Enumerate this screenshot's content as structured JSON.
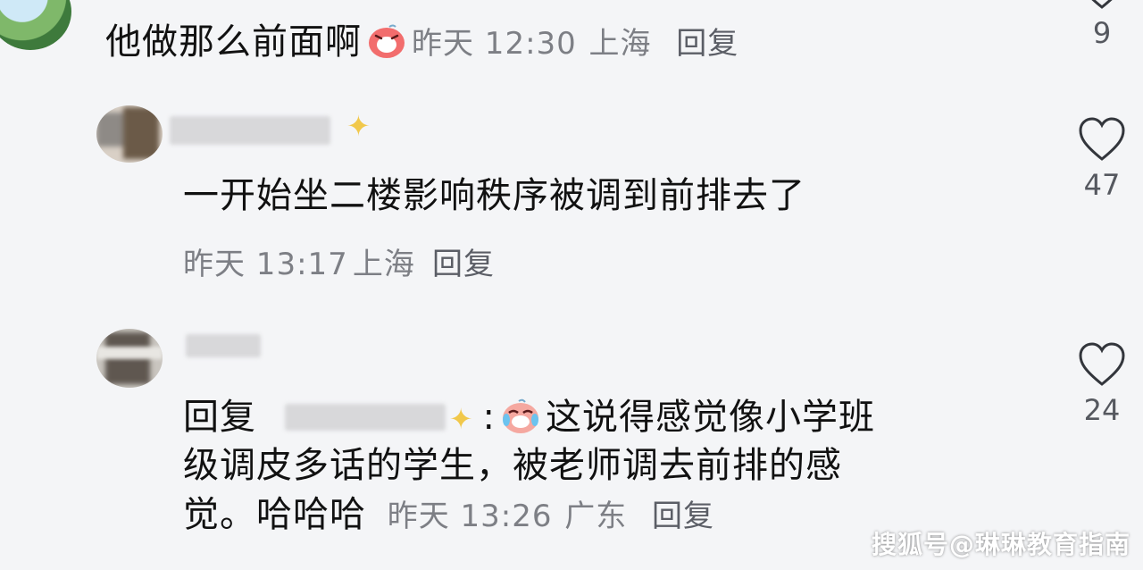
{
  "comments": [
    {
      "text": "他做那么前面啊",
      "emoji": "laughing-face",
      "time": "昨天 12:30",
      "location": "上海",
      "reply_label": "回复",
      "likes": "9"
    },
    {
      "text": "一开始坐二楼影响秩序被调到前排去了",
      "time": "昨天 13:17",
      "location": "上海",
      "reply_label": "回复",
      "likes": "47"
    },
    {
      "reply_prefix": "回复",
      "colon": ":",
      "emoji": "crying-laughing-face",
      "line1": "这说得感觉像小学班",
      "line2": "级调皮多话的学生，被老师调去前排的感",
      "line3": "觉。哈哈哈",
      "time": "昨天 13:26",
      "location": "广东",
      "reply_label": "回复",
      "likes": "24"
    }
  ],
  "watermark": "搜狐号@琳琳教育指南",
  "colors": {
    "text": "#111111",
    "meta": "#7d7f85",
    "background": "#f4f5f7"
  }
}
